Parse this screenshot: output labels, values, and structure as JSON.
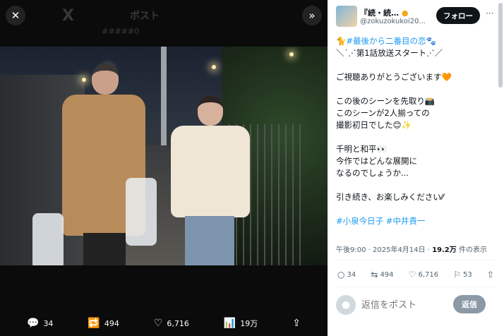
{
  "viewer": {
    "ghost_logo": "X",
    "ghost_title": "ポスト",
    "ghost_sub": "#####0"
  },
  "media_actions": [
    {
      "icon": "reply-icon",
      "glyph": "💬",
      "count": "34"
    },
    {
      "icon": "retweet-icon",
      "glyph": "🔁",
      "count": "494"
    },
    {
      "icon": "like-icon",
      "glyph": "♡",
      "count": "6,716"
    },
    {
      "icon": "views-icon",
      "glyph": "📊",
      "count": "19万"
    },
    {
      "icon": "share-icon",
      "glyph": "⇪",
      "count": ""
    }
  ],
  "author": {
    "name": "『続・続…",
    "handle": "@zokuzokukoi20...",
    "follow_label": "フォロー",
    "more": "···"
  },
  "tweet": {
    "lines": [
      {
        "prefix": "🐈",
        "tag": "#最後から二番目の恋",
        "suffix": "🐾"
      },
      {
        "prefix": "",
        "tag": "",
        "suffix": "＼˙⋰第1話放送スタート⋰／"
      },
      {
        "prefix": "",
        "tag": "",
        "suffix": ""
      },
      {
        "prefix": "",
        "tag": "",
        "suffix": "ご視聴ありがとうございます🧡"
      },
      {
        "prefix": "",
        "tag": "",
        "suffix": ""
      },
      {
        "prefix": "",
        "tag": "",
        "suffix": "この後のシーンを先取り📸"
      },
      {
        "prefix": "",
        "tag": "",
        "suffix": "このシーンが2人揃っての"
      },
      {
        "prefix": "",
        "tag": "",
        "suffix": "撮影初日でした😊✨"
      },
      {
        "prefix": "",
        "tag": "",
        "suffix": ""
      },
      {
        "prefix": "",
        "tag": "",
        "suffix": "千明と和平👀"
      },
      {
        "prefix": "",
        "tag": "",
        "suffix": "今作ではどんな展開に"
      },
      {
        "prefix": "",
        "tag": "",
        "suffix": "なるのでしょうか..."
      },
      {
        "prefix": "",
        "tag": "",
        "suffix": ""
      },
      {
        "prefix": "",
        "tag": "",
        "suffix": "引き続き、お楽しみください⁄⁄"
      },
      {
        "prefix": "",
        "tag": "",
        "suffix": ""
      },
      {
        "prefix": "",
        "tag": "#小泉今日子 #中井貴一",
        "suffix": ""
      }
    ]
  },
  "meta": {
    "time": "午後9:00 · 2025年4月14日 · ",
    "views": "19.2万",
    "views_suffix": " 件の表示"
  },
  "stats": [
    {
      "icon": "reply-icon",
      "glyph": "○",
      "count": "34"
    },
    {
      "icon": "retweet-icon",
      "glyph": "⇆",
      "count": "494"
    },
    {
      "icon": "like-icon",
      "glyph": "♡",
      "count": "6,716"
    },
    {
      "icon": "bookmark-icon",
      "glyph": "⚐",
      "count": "53"
    },
    {
      "icon": "share-icon",
      "glyph": "⇧",
      "count": ""
    }
  ],
  "reply": {
    "placeholder": "返信をポスト",
    "button_label": "返信"
  },
  "colors": {
    "accent": "#1d9bf0",
    "follow_bg": "#0f1419",
    "reply_btn": "#8b98a5"
  }
}
